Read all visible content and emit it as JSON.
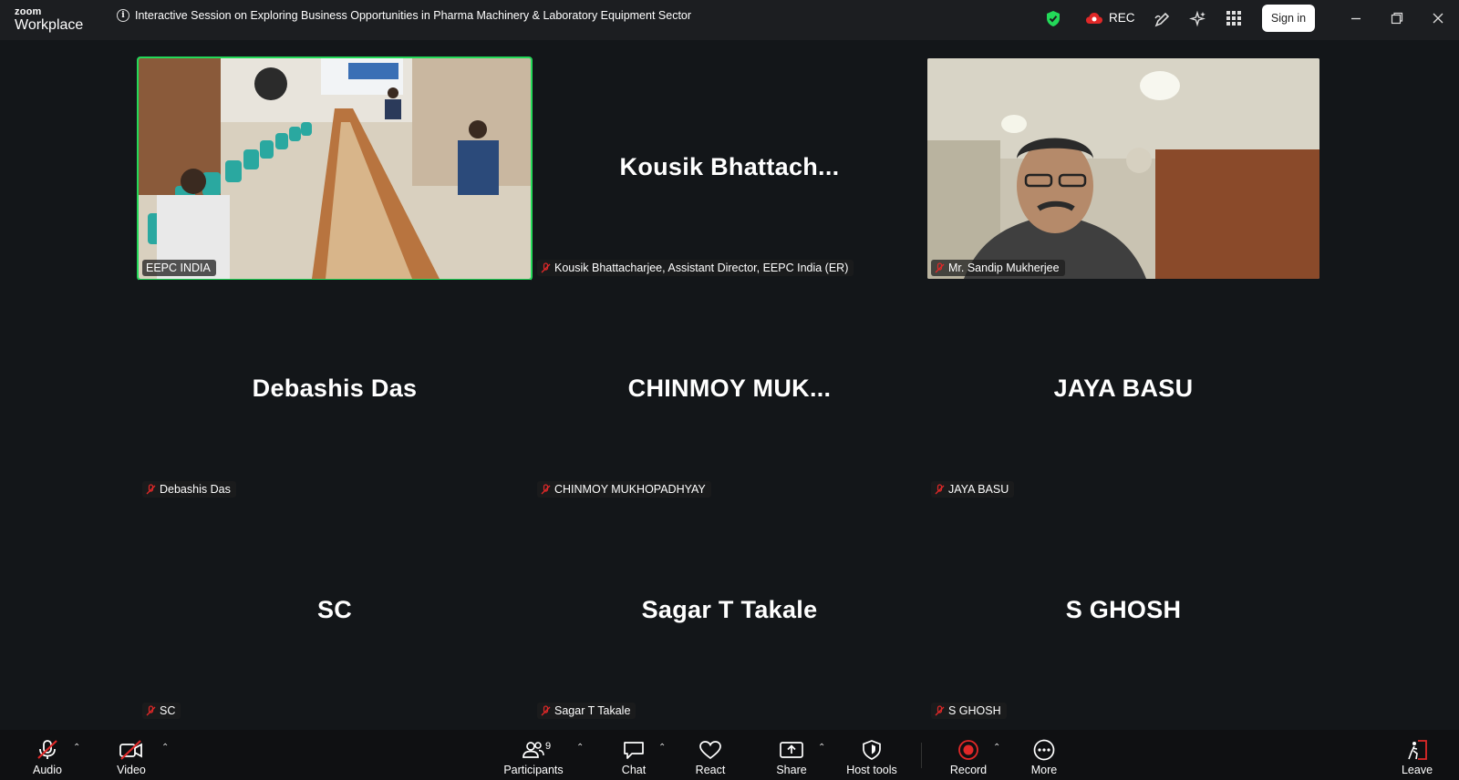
{
  "app": {
    "brand_top": "zoom",
    "brand_bottom": "Workplace"
  },
  "meeting": {
    "title": "Interactive Session on Exploring Business Opportunities in Pharma Machinery & Laboratory Equipment Sector"
  },
  "header": {
    "rec_label": "REC",
    "signin_label": "Sign in"
  },
  "colors": {
    "active_border": "#23d959",
    "rec_red": "#e02828",
    "muted_red": "#e02828",
    "shield_green": "#23d959"
  },
  "tiles": [
    {
      "display": "",
      "tag": "EEPC INDIA",
      "has_video": true,
      "muted": false
    },
    {
      "display": "Kousik  Bhattach...",
      "tag": "Kousik Bhattacharjee, Assistant Director, EEPC India (ER)",
      "has_video": false,
      "muted": true
    },
    {
      "display": "",
      "tag": "Mr. Sandip Mukherjee",
      "has_video": true,
      "muted": true
    },
    {
      "display": "Debashis Das",
      "tag": "Debashis Das",
      "has_video": false,
      "muted": true
    },
    {
      "display": "CHINMOY  MUK...",
      "tag": "CHINMOY MUKHOPADHYAY",
      "has_video": false,
      "muted": true
    },
    {
      "display": "JAYA BASU",
      "tag": "JAYA BASU",
      "has_video": false,
      "muted": true
    },
    {
      "display": "SC",
      "tag": "SC",
      "has_video": false,
      "muted": true
    },
    {
      "display": "Sagar T Takale",
      "tag": "Sagar T Takale",
      "has_video": false,
      "muted": true
    },
    {
      "display": "S GHOSH",
      "tag": "S GHOSH",
      "has_video": false,
      "muted": true
    }
  ],
  "toolbar": {
    "audio": "Audio",
    "video": "Video",
    "participants": "Participants",
    "participants_count": "9",
    "chat": "Chat",
    "react": "React",
    "share": "Share",
    "host_tools": "Host tools",
    "record": "Record",
    "more": "More",
    "leave": "Leave"
  }
}
